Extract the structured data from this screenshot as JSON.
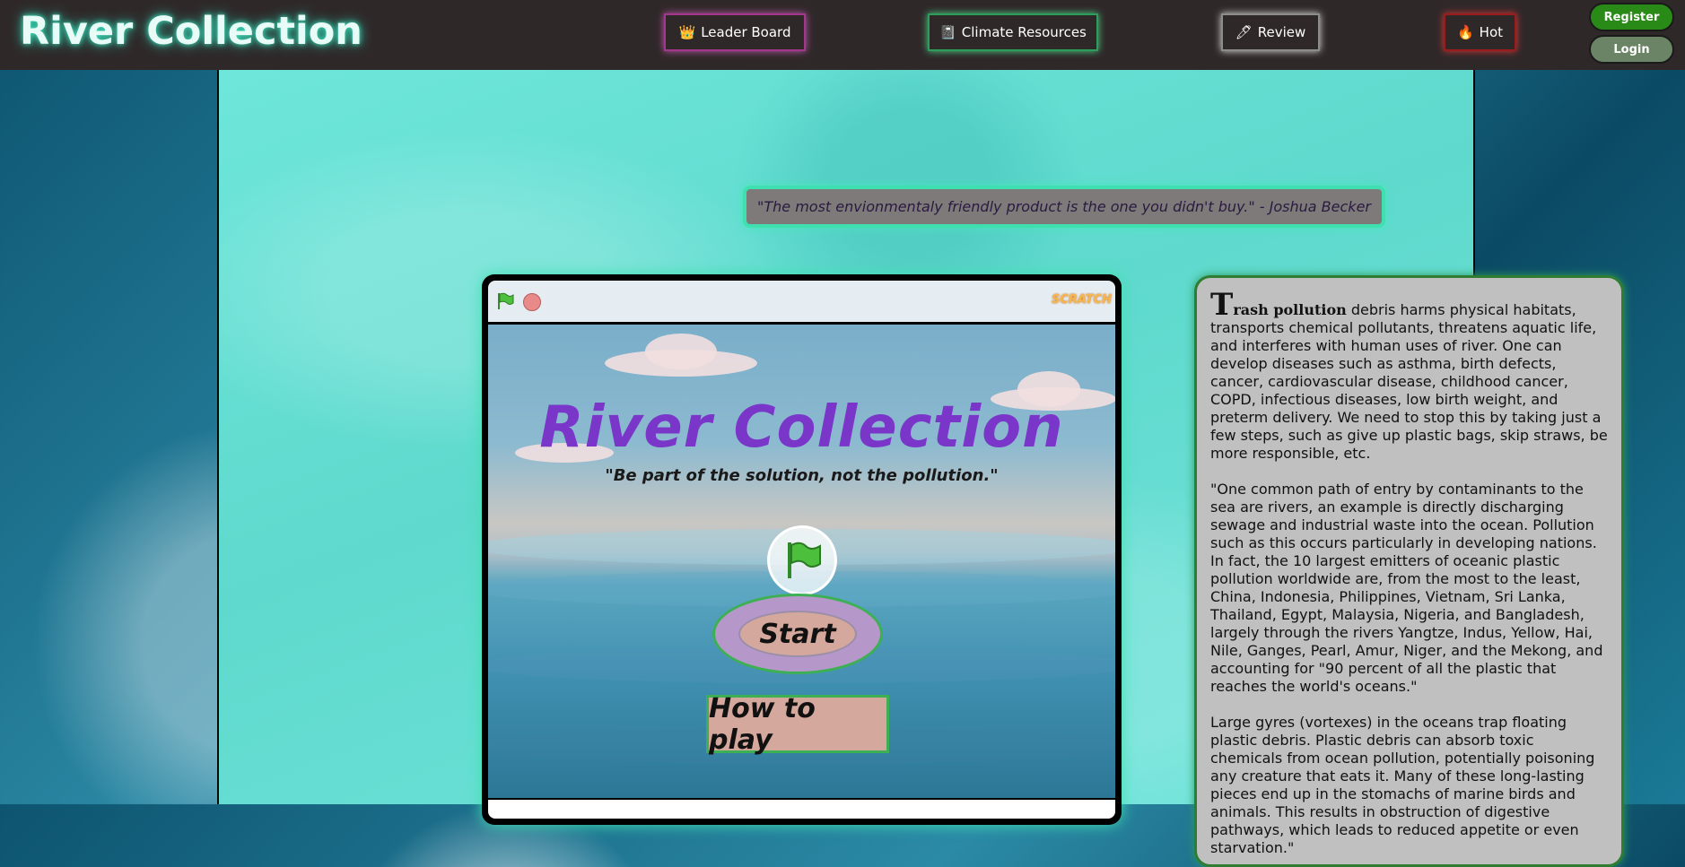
{
  "header": {
    "brand": "River Collection",
    "nav": [
      {
        "icon": "crown-icon",
        "glyph": "👑",
        "label": "Leader Board"
      },
      {
        "icon": "notebook-icon",
        "glyph": "📓",
        "label": "Climate Resources"
      },
      {
        "icon": "pen-icon",
        "glyph": "🖊",
        "label": "Review"
      },
      {
        "icon": "fire-icon",
        "glyph": "🔥",
        "label": "Hot"
      }
    ],
    "register_label": "Register",
    "login_label": "Login"
  },
  "quote": "\"The most envionmentaly friendly product is the one you didn't buy.\" - Joshua Becker",
  "game": {
    "scratch_logo": "SCRATCH",
    "title": "River Collection",
    "subtitle": "\"Be part of the solution, not the pollution.\"",
    "start_label": "Start",
    "howto_label": "How to play"
  },
  "info": {
    "dropcap": "T",
    "lead": "rash pollution",
    "p1_rest": " debris harms physical habitats, transports chemical pollutants, threatens aquatic life, and interferes with human uses of river. One can develop diseases such as asthma, birth defects, cancer, cardiovascular disease, childhood cancer, COPD, infectious diseases, low birth weight, and preterm delivery. We need to stop this by taking just a few steps, such as give up plastic bags, skip straws, be more responsible, etc.",
    "p2": "\"One common path of entry by contaminants to the sea are rivers, an example is directly discharging sewage and industrial waste into the ocean. Pollution such as this occurs particularly in developing nations. In fact, the 10 largest emitters of oceanic plastic pollution worldwide are, from the most to the least, China, Indonesia, Philippines, Vietnam, Sri Lanka, Thailand, Egypt, Malaysia, Nigeria, and Bangladesh, largely through the rivers Yangtze, Indus, Yellow, Hai, Nile, Ganges, Pearl, Amur, Niger, and the Mekong, and accounting for \"90 percent of all the plastic that reaches the world's oceans.\"",
    "p3": "Large gyres (vortexes) in the oceans trap floating plastic debris. Plastic debris can absorb toxic chemicals from ocean pollution, potentially poisoning any creature that eats it. Many of these long-lasting pieces end up in the stomachs of marine birds and animals. This results in obstruction of digestive pathways, which leads to reduced appetite or even starvation.\""
  }
}
